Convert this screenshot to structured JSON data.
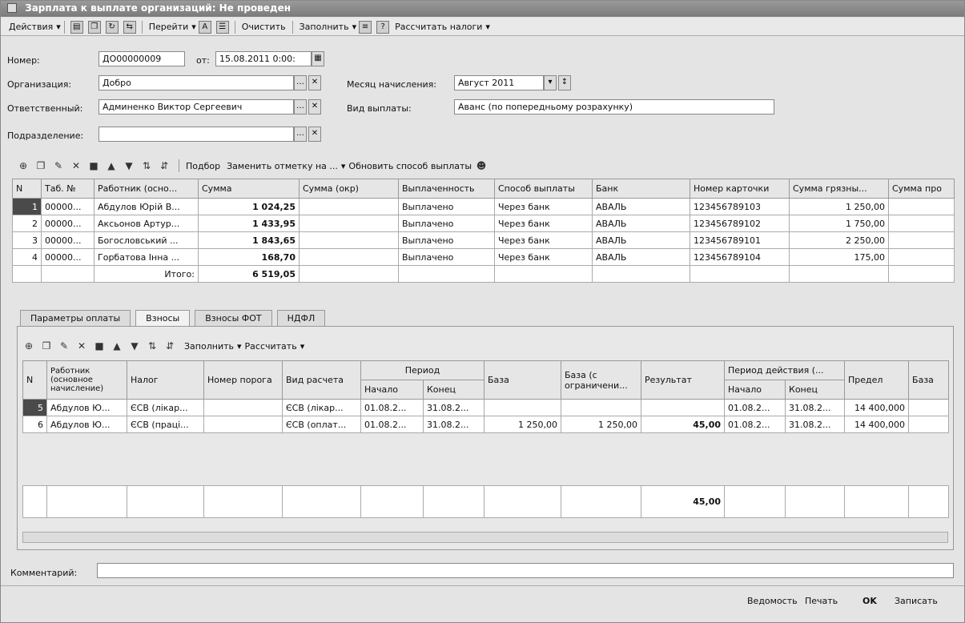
{
  "window": {
    "title": "Зарплата к выплате организаций: Не проведен"
  },
  "toolbar": {
    "actions": "Действия",
    "goto": "Перейти",
    "clear": "Очистить",
    "fill": "Заполнить",
    "calc_taxes": "Рассчитать налоги"
  },
  "form": {
    "number_label": "Номер:",
    "number_value": "ДО00000009",
    "date_label": "от:",
    "date_value": "15.08.2011 0:00:",
    "org_label": "Организация:",
    "org_value": "Добро",
    "responsible_label": "Ответственный:",
    "responsible_value": "Админенко Виктор Сергеевич",
    "department_label": "Подразделение:",
    "department_value": "",
    "month_label": "Месяц начисления:",
    "month_value": "Август 2011",
    "paytype_label": "Вид выплаты:",
    "paytype_value": "Аванс (по попередньому розрахунку)"
  },
  "grid_toolbar": {
    "select": "Подбор",
    "replace_mark": "Заменить отметку на ...",
    "update_method": "Обновить способ выплаты"
  },
  "main_table": {
    "columns": [
      "N",
      "Таб. №",
      "Работник (осно...",
      "Сумма",
      "Сумма (окр)",
      "Выплаченность",
      "Способ выплаты",
      "Банк",
      "Номер карточки",
      "Сумма грязны...",
      "Сумма про"
    ],
    "rows": [
      [
        "1",
        "00000...",
        "Абдулов Юрій В...",
        "1 024,25",
        "",
        "Выплачено",
        "Через банк",
        "АВАЛЬ",
        "123456789103",
        "1 250,00",
        ""
      ],
      [
        "2",
        "00000...",
        "Аксьонов Артур...",
        "1 433,95",
        "",
        "Выплачено",
        "Через банк",
        "АВАЛЬ",
        "123456789102",
        "1 750,00",
        ""
      ],
      [
        "3",
        "00000...",
        "Богословський ...",
        "1 843,65",
        "",
        "Выплачено",
        "Через банк",
        "АВАЛЬ",
        "123456789101",
        "2 250,00",
        ""
      ],
      [
        "4",
        "00000...",
        "Горбатова Інна ...",
        "168,70",
        "",
        "Выплачено",
        "Через банк",
        "АВАЛЬ",
        "123456789104",
        "175,00",
        ""
      ]
    ],
    "total_label": "Итого:",
    "total_value": "6 519,05"
  },
  "tabs": [
    "Параметры оплаты",
    "Взносы",
    "Взносы ФОТ",
    "НДФЛ"
  ],
  "sub_toolbar": {
    "fill": "Заполнить",
    "calculate": "Рассчитать"
  },
  "sub_table": {
    "headers": {
      "n": "N",
      "worker": "Работник (основное начисление)",
      "tax": "Налог",
      "threshold": "Номер порога",
      "calc_type": "Вид расчета",
      "period": "Период",
      "start": "Начало",
      "end": "Конец",
      "base": "База",
      "base_limited": "База (с ограничени...",
      "result": "Результат",
      "action_period": "Период действия (...",
      "limit": "Предел",
      "base2": "База"
    },
    "rows": [
      [
        "5",
        "Абдулов Ю...",
        "ЄСВ (лікар...",
        "",
        "ЄСВ (лікар...",
        "01.08.2...",
        "31.08.2...",
        "",
        "",
        "",
        "01.08.2...",
        "31.08.2...",
        "14 400,000",
        ""
      ],
      [
        "6",
        "Абдулов Ю...",
        "ЄСВ (праці...",
        "",
        "ЄСВ (оплат...",
        "01.08.2...",
        "31.08.2...",
        "1 250,00",
        "1 250,00",
        "45,00",
        "01.08.2...",
        "31.08.2...",
        "14 400,000",
        ""
      ]
    ],
    "total_result": "45,00"
  },
  "comment": {
    "label": "Комментарий:",
    "value": ""
  },
  "bottom": {
    "report": "Ведомость",
    "print": "Печать",
    "ok": "OK",
    "save": "Записать"
  }
}
